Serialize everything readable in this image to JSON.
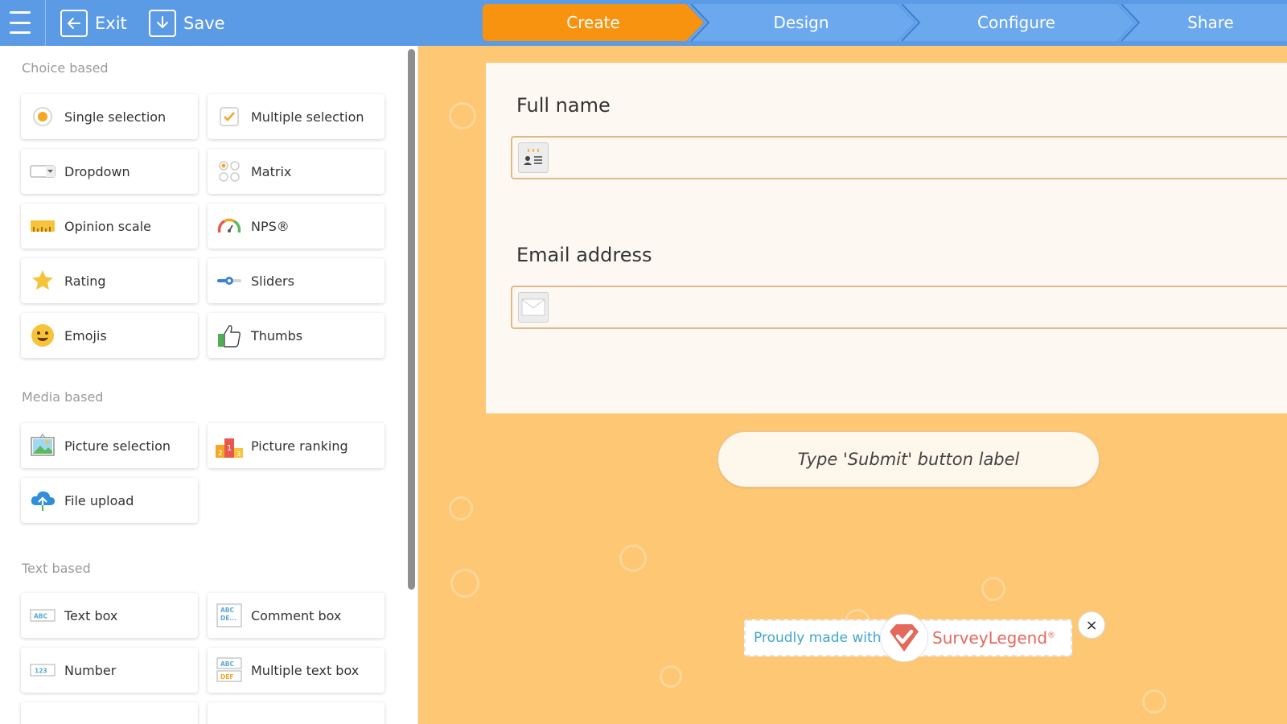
{
  "topbar": {
    "exit_label": "Exit",
    "save_label": "Save",
    "steps": [
      {
        "label": "Create",
        "active": true
      },
      {
        "label": "Design",
        "active": false
      },
      {
        "label": "Configure",
        "active": false
      },
      {
        "label": "Share",
        "active": false
      }
    ]
  },
  "sidebar": {
    "choice_title": "Choice based",
    "choice_items": [
      {
        "label": "Single selection",
        "icon": "radio-icon"
      },
      {
        "label": "Multiple selection",
        "icon": "checkbox-icon"
      },
      {
        "label": "Dropdown",
        "icon": "dropdown-icon"
      },
      {
        "label": "Matrix",
        "icon": "matrix-icon"
      },
      {
        "label": "Opinion scale",
        "icon": "ruler-icon"
      },
      {
        "label": "NPS®",
        "icon": "gauge-icon"
      },
      {
        "label": "Rating",
        "icon": "star-icon"
      },
      {
        "label": "Sliders",
        "icon": "slider-icon"
      },
      {
        "label": "Emojis",
        "icon": "emoji-icon"
      },
      {
        "label": "Thumbs",
        "icon": "thumbs-up-icon"
      }
    ],
    "media_title": "Media based",
    "media_items": [
      {
        "label": "Picture selection",
        "icon": "picture-icon"
      },
      {
        "label": "Picture ranking",
        "icon": "podium-icon"
      },
      {
        "label": "File upload",
        "icon": "cloud-upload-icon"
      }
    ],
    "text_title": "Text based",
    "text_items": [
      {
        "label": "Text box",
        "icon": "abc-icon"
      },
      {
        "label": "Comment box",
        "icon": "abc-de-icon"
      },
      {
        "label": "Number",
        "icon": "number-icon"
      },
      {
        "label": "Multiple text box",
        "icon": "abc-def-icon"
      }
    ]
  },
  "form": {
    "q1_label": "Full name",
    "q2_label": "Email address",
    "submit_placeholder": "Type 'Submit' button label"
  },
  "badge": {
    "proud_text": "Proudly made with",
    "brand_text": "SurveyLegend",
    "reg_mark": "®",
    "close_label": "×"
  },
  "colors": {
    "topbar": "#5b9be6",
    "active_step": "#f7930f",
    "canvas": "#fdc774",
    "brand": "#e5685c",
    "proud": "#3fa6cf"
  }
}
